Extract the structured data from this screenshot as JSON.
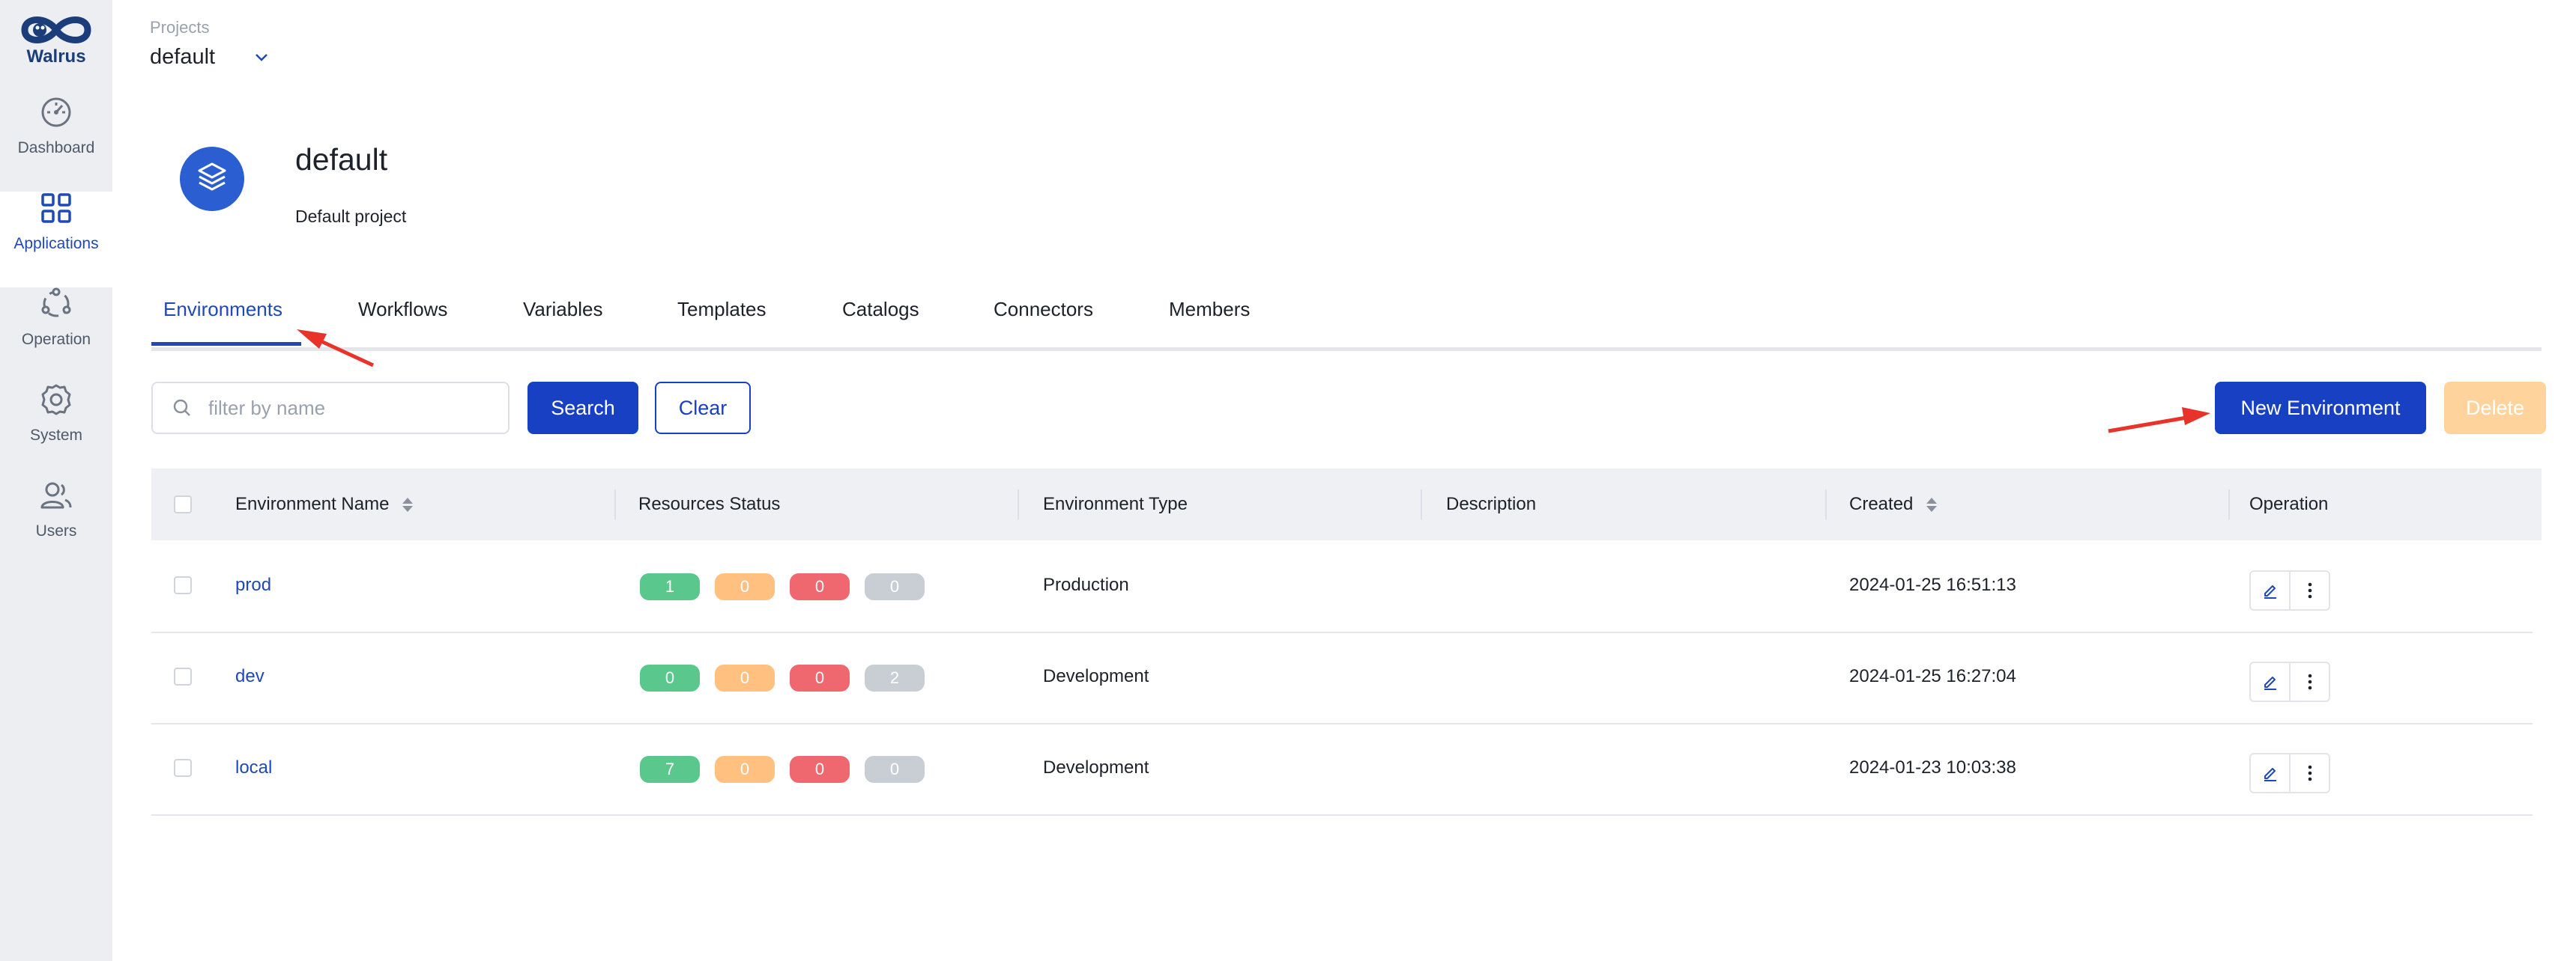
{
  "colors": {
    "brand": "#1f48b8",
    "primary_button": "#1840c2",
    "status_ready": "#5ac88c",
    "status_pending": "#ffc080",
    "status_error": "#f0686f",
    "status_unknown": "#c9cdd4",
    "annotation_arrow": "#e8332a"
  },
  "app": {
    "logo_text": "Walrus"
  },
  "sidebar": {
    "items": [
      {
        "label": "Dashboard",
        "icon": "dashboard-icon"
      },
      {
        "label": "Applications",
        "icon": "applications-icon",
        "active": true
      },
      {
        "label": "Operation",
        "icon": "operation-icon"
      },
      {
        "label": "System",
        "icon": "gear-icon"
      },
      {
        "label": "Users",
        "icon": "users-icon"
      }
    ]
  },
  "project_selector": {
    "label": "Projects",
    "value": "default"
  },
  "project": {
    "name": "default",
    "description": "Default project",
    "icon": "layers-icon"
  },
  "tabs": [
    {
      "label": "Environments",
      "active": true
    },
    {
      "label": "Workflows"
    },
    {
      "label": "Variables"
    },
    {
      "label": "Templates"
    },
    {
      "label": "Catalogs"
    },
    {
      "label": "Connectors"
    },
    {
      "label": "Members"
    }
  ],
  "toolbar": {
    "search_placeholder": "filter by name",
    "search_value": "",
    "search_label": "Search",
    "clear_label": "Clear",
    "new_label": "New Environment",
    "delete_label": "Delete"
  },
  "table": {
    "columns": [
      "Environment Name",
      "Resources Status",
      "Environment Type",
      "Description",
      "Created",
      "Operation"
    ],
    "rows": [
      {
        "name": "prod",
        "status": [
          "1",
          "0",
          "0",
          "0"
        ],
        "type": "Production",
        "description": "",
        "created": "2024-01-25 16:51:13"
      },
      {
        "name": "dev",
        "status": [
          "0",
          "0",
          "0",
          "2"
        ],
        "type": "Development",
        "description": "",
        "created": "2024-01-25 16:27:04"
      },
      {
        "name": "local",
        "status": [
          "7",
          "0",
          "0",
          "0"
        ],
        "type": "Development",
        "description": "",
        "created": "2024-01-23 10:03:38"
      }
    ],
    "operation_icons": [
      "edit-icon",
      "more-vertical-icon"
    ]
  }
}
